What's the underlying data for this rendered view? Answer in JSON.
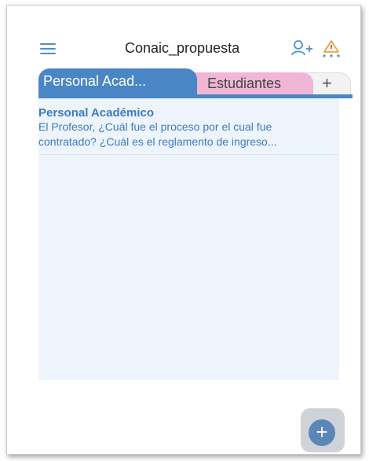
{
  "header": {
    "title": "Conaic_propuesta",
    "menu_icon": "hamburger-icon",
    "add_user_icon": "add-user-icon",
    "alert_icon": "warning-icon"
  },
  "tabs": [
    {
      "label": "Personal Acad...",
      "active": true,
      "color": "#4a86c6"
    },
    {
      "label": "Estudiantes",
      "active": false,
      "color": "#efb6d6"
    },
    {
      "label": "+",
      "active": false,
      "color": "#f2f2f2"
    }
  ],
  "list": {
    "items": [
      {
        "title": "Personal Académico",
        "line1": "El Profesor, ¿Cuál fue el proceso por el cual fue",
        "line2": "contratado?  ¿Cuál es el reglamento de ingreso..."
      }
    ]
  },
  "fab": {
    "label": "+",
    "icon": "add-icon"
  },
  "colors": {
    "accent": "#4a86c6",
    "link_text": "#3a7cc4",
    "alert": "#e8a531"
  }
}
